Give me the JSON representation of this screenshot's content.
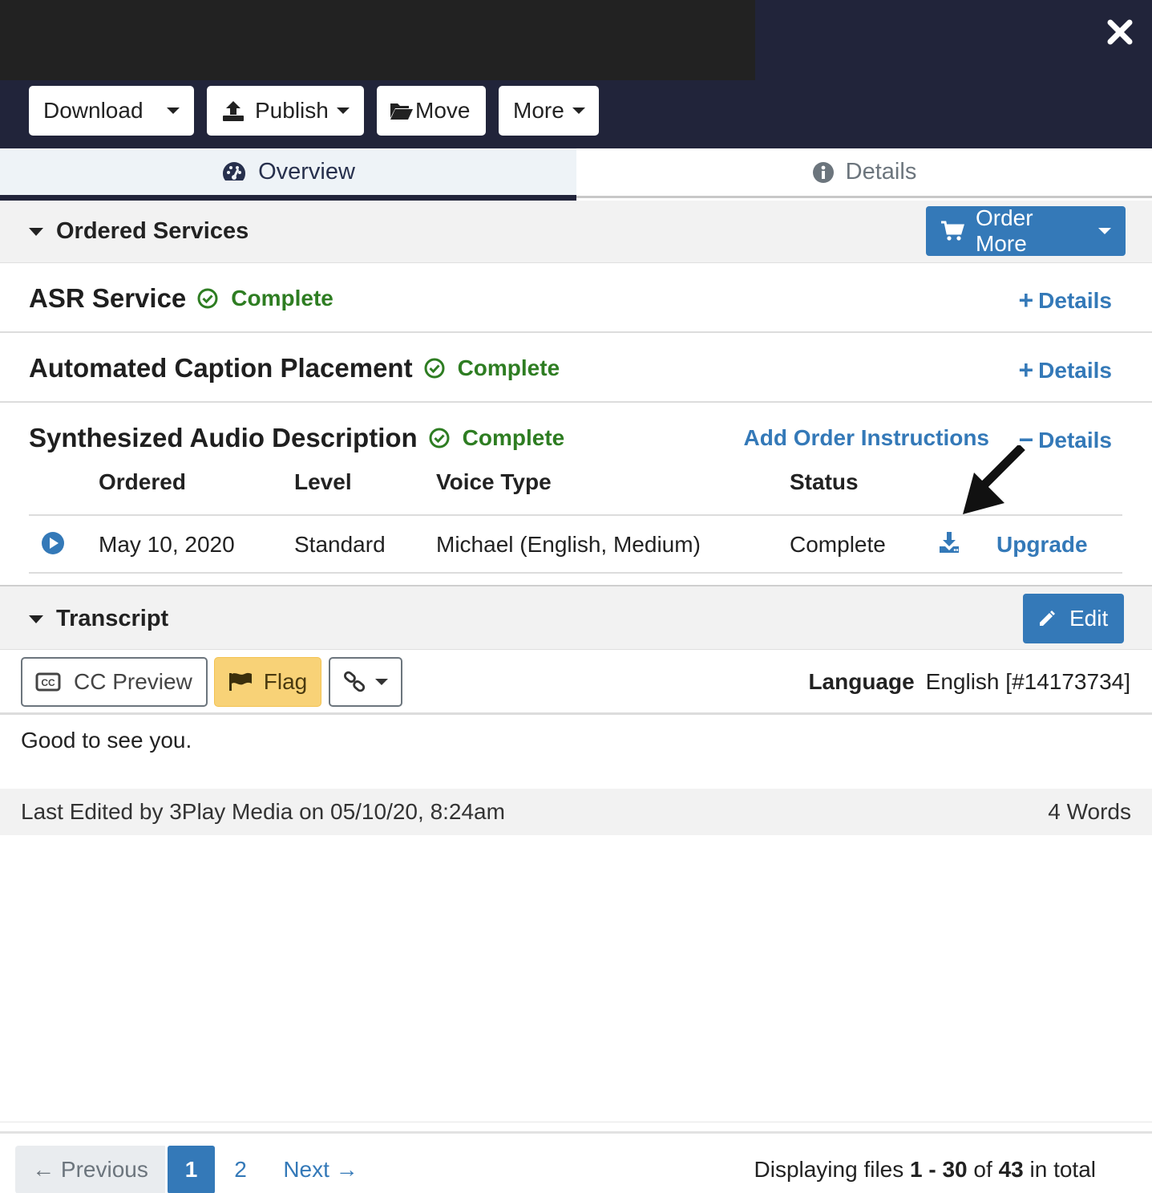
{
  "toolbar": {
    "download": "Download",
    "publish": "Publish",
    "move": "Move",
    "more": "More"
  },
  "tabs": {
    "overview": "Overview",
    "details": "Details"
  },
  "ordered_services": {
    "title": "Ordered Services",
    "order_more": "Order More",
    "services": [
      {
        "name": "ASR Service",
        "status": "Complete",
        "details": "Details"
      },
      {
        "name": "Automated Caption Placement",
        "status": "Complete",
        "details": "Details"
      },
      {
        "name": "Synthesized Audio Description",
        "status": "Complete",
        "details": "Details",
        "add_instructions": "Add Order Instructions"
      }
    ],
    "table": {
      "headers": [
        "Ordered",
        "Level",
        "Voice Type",
        "Status"
      ],
      "row": {
        "ordered": "May 10, 2020",
        "level": "Standard",
        "voice_type": "Michael (English, Medium)",
        "status": "Complete",
        "upgrade": "Upgrade"
      }
    }
  },
  "transcript": {
    "title": "Transcript",
    "edit": "Edit",
    "cc_preview": "CC Preview",
    "flag": "Flag",
    "language_label": "Language",
    "language_value": "English [#14173734]",
    "text": "Good to see you.",
    "last_edited": "Last Edited by 3Play Media on 05/10/20, 8:24am",
    "word_count": "4 Words"
  },
  "pagination": {
    "previous": "← Previous",
    "page1": "1",
    "page2": "2",
    "next": "Next →",
    "display_prefix": "Displaying files ",
    "display_range": "1 - 30",
    "display_of": " of ",
    "display_total": "43",
    "display_suffix": " in total"
  },
  "colors": {
    "header_bg": "#21243a",
    "link_blue": "#3479b8",
    "complete_green": "#2e7d22",
    "flag_yellow": "#f8d277"
  }
}
